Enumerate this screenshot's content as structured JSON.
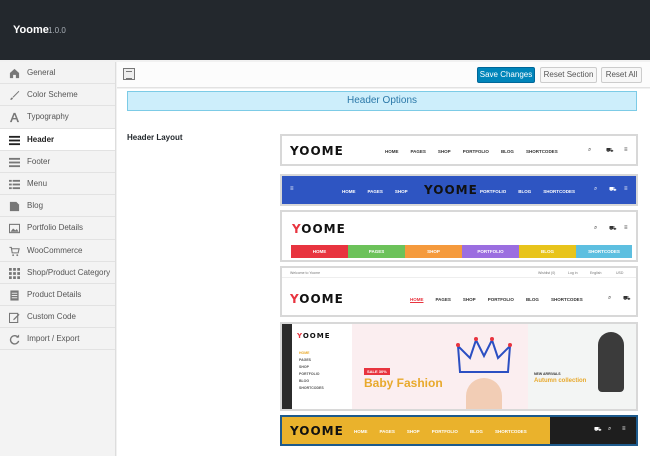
{
  "app": {
    "title": "Yoome",
    "version": "1.0.0"
  },
  "sidebar": {
    "items": [
      {
        "label": "General",
        "icon": "home-icon"
      },
      {
        "label": "Color Scheme",
        "icon": "brush-icon"
      },
      {
        "label": "Typography",
        "icon": "typography-icon"
      },
      {
        "label": "Header",
        "icon": "header-icon",
        "active": true
      },
      {
        "label": "Footer",
        "icon": "footer-icon"
      },
      {
        "label": "Menu",
        "icon": "menu-icon"
      },
      {
        "label": "Blog",
        "icon": "blog-icon"
      },
      {
        "label": "Portfolio Details",
        "icon": "image-icon"
      },
      {
        "label": "WooCommerce",
        "icon": "cart-icon"
      },
      {
        "label": "Shop/Product Category",
        "icon": "grid-icon"
      },
      {
        "label": "Product Details",
        "icon": "page-icon"
      },
      {
        "label": "Custom Code",
        "icon": "edit-icon"
      },
      {
        "label": "Import / Export",
        "icon": "refresh-icon"
      }
    ]
  },
  "toolbar": {
    "save_label": "Save Changes",
    "reset_section_label": "Reset Section",
    "reset_all_label": "Reset All"
  },
  "section": {
    "title": "Header Options",
    "field_label": "Header Layout"
  },
  "header_preview": {
    "logo_rest": "OOME",
    "logo_y": "Y",
    "nav_caps": [
      "HOME",
      "PAGES",
      "SHOP",
      "PORTFOLIO",
      "BLOG",
      "SHORTCODES"
    ],
    "nav_split_left": [
      "HOME",
      "PAGES",
      "SHOP"
    ],
    "nav_split_right": [
      "PORTFOLIO",
      "BLOG",
      "SHORTCODES"
    ],
    "nav_colored": [
      "HOME",
      "PAGES",
      "SHOP",
      "PORTFOLIO",
      "BLOG",
      "SHORTCODES"
    ],
    "nav_colors": [
      "#e8343f",
      "#6cc25a",
      "#f59a3c",
      "#9b6ee0",
      "#e8c41b",
      "#5dbfe0"
    ],
    "topbar_welcome": "Welcome to Yoome",
    "topbar_wishlist": "Wishlist (0)",
    "topbar_login": "Log in",
    "topbar_lang": "English",
    "topbar_currency": "USD",
    "side_menu": [
      "HOME",
      "PAGES",
      "SHOP",
      "PORTFOLIO",
      "BLOG",
      "SHORTCODES"
    ],
    "banner_sale": "SALE 30%",
    "banner_headline": "Baby Fashion",
    "banner_small": "NEW ARRIVALS",
    "banner_collection": "Autumn collection",
    "nav_yellow": [
      "HOME",
      "PAGES",
      "SHOP",
      "PORTFOLIO",
      "BLOG",
      "SHORTCODES"
    ]
  },
  "colors": {
    "primary": "#0085ba",
    "blue_header": "#2e55c2",
    "yellow_header": "#eab22c",
    "dark_panel": "#23282d"
  }
}
